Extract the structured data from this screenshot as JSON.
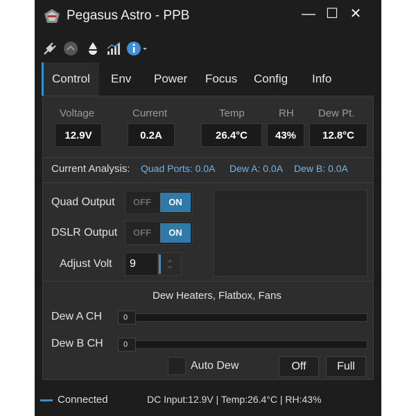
{
  "window": {
    "title": "Pegasus Astro - PPB",
    "controls": {
      "minimize": "—",
      "maximize": "☐",
      "close": "✕"
    }
  },
  "toolbar": {
    "icons": [
      "plug-icon",
      "chevron-up-icon",
      "drop-icon",
      "chart-icon",
      "info-icon"
    ]
  },
  "tabs": [
    "Control",
    "Env",
    "Power",
    "Focus",
    "Config",
    "Info"
  ],
  "active_tab": "Control",
  "readings": {
    "voltage": {
      "label": "Voltage",
      "value": "12.9V"
    },
    "current": {
      "label": "Current",
      "value": "0.2A"
    },
    "temp": {
      "label": "Temp",
      "value": "26.4°C"
    },
    "rh": {
      "label": "RH",
      "value": "43%"
    },
    "dewpt": {
      "label": "Dew Pt.",
      "value": "12.8°C"
    }
  },
  "analysis": {
    "label": "Current Analysis:",
    "quad": "Quad Ports: 0.0A",
    "dew_a": "Dew A: 0.0A",
    "dew_b": "Dew B: 0.0A"
  },
  "outputs": {
    "quad": {
      "label": "Quad Output",
      "off": "OFF",
      "on": "ON"
    },
    "dslr": {
      "label": "DSLR Output",
      "off": "OFF",
      "on": "ON"
    },
    "adjust": {
      "label": "Adjust Volt",
      "value": "9"
    }
  },
  "dew": {
    "heading": "Dew Heaters, Flatbox, Fans",
    "a": {
      "label": "Dew A CH",
      "value": "0"
    },
    "b": {
      "label": "Dew B CH",
      "value": "0"
    },
    "auto_label": "Auto Dew",
    "off_label": "Off",
    "full_label": "Full"
  },
  "status": {
    "connection": "Connected",
    "info": "DC Input:12.9V | Temp:26.4°C | RH:43%"
  },
  "colors": {
    "accent": "#3a8fc8",
    "on_toggle": "#2f7aa8",
    "analysis_text": "#74b4e8"
  }
}
